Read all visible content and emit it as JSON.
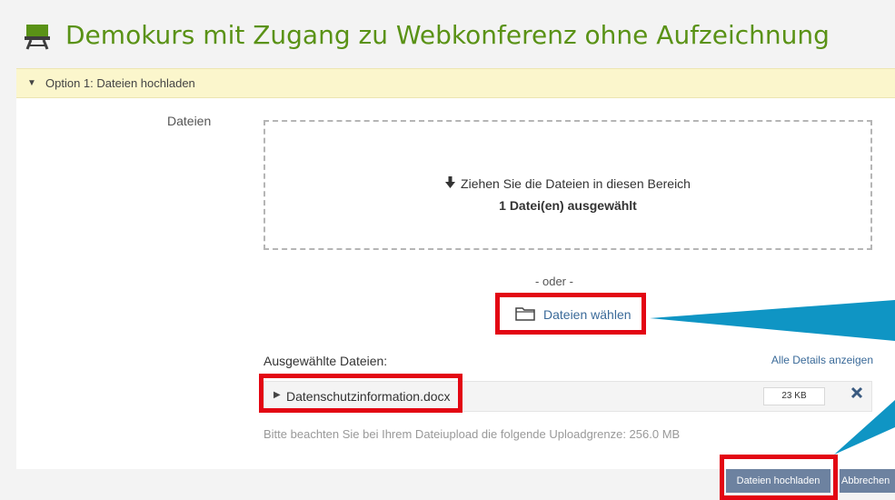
{
  "header": {
    "title": "Demokurs mit Zugang zu Webkonferenz ohne Aufzeichnung"
  },
  "option": {
    "arrow": "▼",
    "title": "Option 1: Dateien hochladen"
  },
  "files_field": {
    "label": "Dateien"
  },
  "dropzone": {
    "arrow": "🡇",
    "instruction": "Ziehen Sie die Dateien in diesen Bereich",
    "status": "1 Datei(en) ausgewählt"
  },
  "separator": "- oder -",
  "choose": {
    "label": "Dateien wählen"
  },
  "selected": {
    "heading": "Ausgewählte Dateien:",
    "details_link": "Alle Details anzeigen"
  },
  "file": {
    "expand_arrow": "▶",
    "name": "Datenschutzinformation.docx",
    "size": "23 KB"
  },
  "note": "Bitte beachten Sie bei Ihrem Dateiupload die folgende Uploadgrenze: 256.0 MB",
  "buttons": {
    "upload": "Dateien hochladen",
    "cancel": "Abbrechen"
  },
  "colors": {
    "title_green": "#5a9216",
    "highlight_red": "#e30613",
    "callout_blue": "#0f95c4",
    "button_blue": "#6d82a0",
    "option_yellow": "#fbf6cc"
  },
  "icons": [
    "course-icon",
    "folder-icon",
    "remove-icon",
    "download-arrow-icon"
  ]
}
